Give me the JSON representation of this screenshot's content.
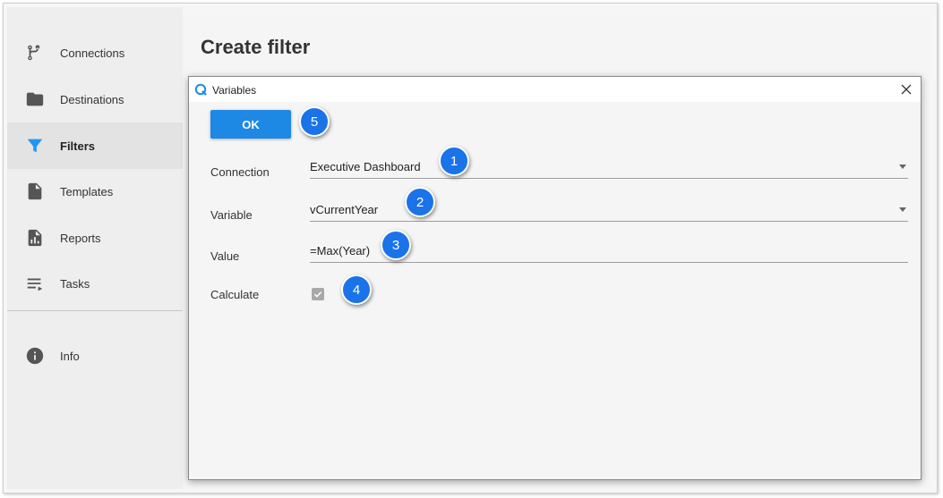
{
  "sidebar": {
    "items": [
      {
        "label": "Connections",
        "icon": "source-branch-icon",
        "active": false
      },
      {
        "label": "Destinations",
        "icon": "folder-icon",
        "active": false
      },
      {
        "label": "Filters",
        "icon": "filter-icon",
        "active": true
      },
      {
        "label": "Templates",
        "icon": "file-icon",
        "active": false
      },
      {
        "label": "Reports",
        "icon": "report-icon",
        "active": false
      },
      {
        "label": "Tasks",
        "icon": "tasks-icon",
        "active": false
      },
      {
        "label": "Info",
        "icon": "info-icon",
        "active": false
      }
    ]
  },
  "main": {
    "title": "Create filter"
  },
  "dialog": {
    "title": "Variables",
    "ok_label": "OK",
    "fields": {
      "connection": {
        "label": "Connection",
        "value": "Executive Dashboard"
      },
      "variable": {
        "label": "Variable",
        "value": "vCurrentYear"
      },
      "value": {
        "label": "Value",
        "value": "=Max(Year)"
      },
      "calculate": {
        "label": "Calculate",
        "checked": true
      }
    }
  },
  "callouts": [
    "1",
    "2",
    "3",
    "4",
    "5"
  ],
  "colors": {
    "accent": "#1e88e5",
    "badge": "#1a73e8",
    "sidebar_bg": "#eeeeee",
    "active_item_bg": "#e3e3e3"
  }
}
